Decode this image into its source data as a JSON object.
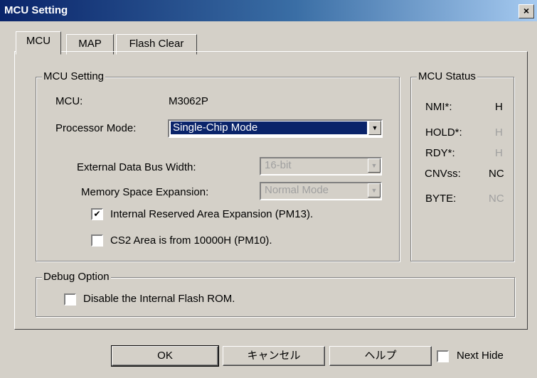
{
  "window": {
    "title": "MCU Setting",
    "close_glyph": "×"
  },
  "tabs": [
    {
      "label": "MCU",
      "active": true
    },
    {
      "label": "MAP",
      "active": false
    },
    {
      "label": "Flash Clear",
      "active": false
    }
  ],
  "mcu_setting": {
    "group_title": "MCU Setting",
    "mcu_label": "MCU:",
    "mcu_value": "M3062P",
    "processor_mode_label": "Processor Mode:",
    "processor_mode_value": "Single-Chip Mode",
    "ext_bus_label": "External Data Bus Width:",
    "ext_bus_value": "16-bit",
    "mem_exp_label": "Memory Space Expansion:",
    "mem_exp_value": "Normal Mode",
    "reserved_area_label": "Internal Reserved Area Expansion (PM13).",
    "reserved_area_checked": true,
    "cs2_label": "CS2 Area is from 10000H (PM10).",
    "cs2_checked": false
  },
  "mcu_status": {
    "group_title": "MCU Status",
    "rows": [
      {
        "label": "NMI*:",
        "value": "H",
        "enabled": true
      },
      {
        "label": "HOLD*:",
        "value": "H",
        "enabled": false
      },
      {
        "label": "RDY*:",
        "value": "H",
        "enabled": false
      },
      {
        "label": "CNVss:",
        "value": "NC",
        "enabled": true
      },
      {
        "label": "BYTE:",
        "value": "NC",
        "enabled": false
      }
    ]
  },
  "debug_option": {
    "group_title": "Debug Option",
    "disable_flash_label": "Disable the Internal Flash ROM.",
    "disable_flash_checked": false
  },
  "footer": {
    "ok_label": "OK",
    "cancel_label": "キャンセル",
    "help_label": "ヘルプ",
    "next_hide_label": "Next Hide",
    "next_hide_checked": false
  },
  "icons": {
    "check_mark": "✔",
    "dropdown_arrow": "▼"
  }
}
